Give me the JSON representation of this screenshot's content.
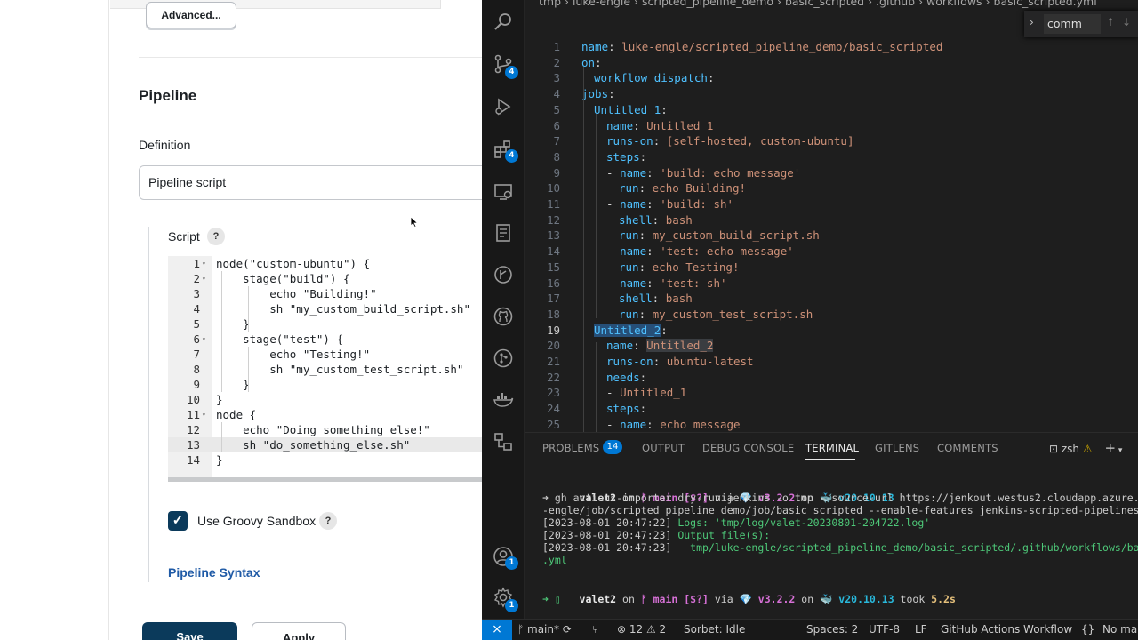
{
  "jenkins": {
    "advanced_button": "Advanced...",
    "section_title": "Pipeline",
    "definition_label": "Definition",
    "definition_value": "Pipeline script",
    "script_label": "Script",
    "help_glyph": "?",
    "script_lines": [
      {
        "n": "1",
        "fold": "▾",
        "code": "node(\"custom-ubuntu\") {"
      },
      {
        "n": "2",
        "fold": "▾",
        "code": "    stage(\"build\") {"
      },
      {
        "n": "3",
        "fold": "",
        "code": "        echo \"Building!\""
      },
      {
        "n": "4",
        "fold": "",
        "code": "        sh \"my_custom_build_script.sh\""
      },
      {
        "n": "5",
        "fold": "",
        "code": "    }"
      },
      {
        "n": "6",
        "fold": "▾",
        "code": "    stage(\"test\") {"
      },
      {
        "n": "7",
        "fold": "",
        "code": "        echo \"Testing!\""
      },
      {
        "n": "8",
        "fold": "",
        "code": "        sh \"my_custom_test_script.sh\""
      },
      {
        "n": "9",
        "fold": "",
        "code": "    }"
      },
      {
        "n": "10",
        "fold": "",
        "code": "}"
      },
      {
        "n": "11",
        "fold": "▾",
        "code": "node {"
      },
      {
        "n": "12",
        "fold": "",
        "code": "    echo \"Doing something else!\""
      },
      {
        "n": "13",
        "fold": "",
        "code": "    sh \"do_something_else.sh\""
      },
      {
        "n": "14",
        "fold": "",
        "code": "}"
      }
    ],
    "active_script_line": "13",
    "sandbox_label": "Use Groovy Sandbox",
    "sandbox_checked": true,
    "pipeline_syntax_link": "Pipeline Syntax",
    "save_button": "Save",
    "apply_button": "Apply"
  },
  "vscode": {
    "breadcrumb": "tmp  ›  luke-engle  ›  scripted_pipeline_demo  ›  basic_scripted  ›  .github  ›  workflows  ›  basic_scripted.yml",
    "find_text": "comm",
    "activity_badges": {
      "source_control": "4",
      "extensions": "4",
      "accounts": "1",
      "settings": "1"
    },
    "yaml_lines": [
      {
        "n": "1",
        "indent": 0,
        "key": "name",
        "val": "luke-engle/scripted_pipeline_demo/basic_scripted"
      },
      {
        "n": "2",
        "indent": 0,
        "key": "on",
        "val": ""
      },
      {
        "n": "3",
        "indent": 1,
        "key": "workflow_dispatch",
        "val": ""
      },
      {
        "n": "4",
        "indent": 0,
        "key": "jobs",
        "val": ""
      },
      {
        "n": "5",
        "indent": 1,
        "key": "Untitled_1",
        "val": ""
      },
      {
        "n": "6",
        "indent": 2,
        "key": "name",
        "val": "Untitled_1"
      },
      {
        "n": "7",
        "indent": 2,
        "key": "runs-on",
        "val": "[self-hosted, custom-ubuntu]"
      },
      {
        "n": "8",
        "indent": 2,
        "key": "steps",
        "val": ""
      },
      {
        "n": "9",
        "indent": 2,
        "dash": true,
        "key": "name",
        "val": "'build: echo message'"
      },
      {
        "n": "10",
        "indent": 3,
        "key": "run",
        "val": "echo Building!"
      },
      {
        "n": "11",
        "indent": 2,
        "dash": true,
        "key": "name",
        "val": "'build: sh'"
      },
      {
        "n": "12",
        "indent": 3,
        "key": "shell",
        "val": "bash"
      },
      {
        "n": "13",
        "indent": 3,
        "key": "run",
        "val": "my_custom_build_script.sh"
      },
      {
        "n": "14",
        "indent": 2,
        "dash": true,
        "key": "name",
        "val": "'test: echo message'"
      },
      {
        "n": "15",
        "indent": 3,
        "key": "run",
        "val": "echo Testing!"
      },
      {
        "n": "16",
        "indent": 2,
        "dash": true,
        "key": "name",
        "val": "'test: sh'"
      },
      {
        "n": "17",
        "indent": 3,
        "key": "shell",
        "val": "bash"
      },
      {
        "n": "18",
        "indent": 3,
        "key": "run",
        "val": "my_custom_test_script.sh"
      },
      {
        "n": "19",
        "indent": 1,
        "key": "Untitled_2",
        "val": "",
        "highlight": true
      },
      {
        "n": "20",
        "indent": 2,
        "key": "name",
        "val": "Untitled_2",
        "valhl": true
      },
      {
        "n": "21",
        "indent": 2,
        "key": "runs-on",
        "val": "ubuntu-latest"
      },
      {
        "n": "22",
        "indent": 2,
        "key": "needs",
        "val": ""
      },
      {
        "n": "23",
        "indent": 2,
        "dash": true,
        "key": "",
        "val": "Untitled_1"
      },
      {
        "n": "24",
        "indent": 2,
        "key": "steps",
        "val": ""
      },
      {
        "n": "25",
        "indent": 2,
        "dash": true,
        "key": "name",
        "val": "echo message"
      }
    ],
    "current_line": "19",
    "panel_tabs": [
      "PROBLEMS",
      "OUTPUT",
      "DEBUG CONSOLE",
      "TERMINAL",
      "GITLENS",
      "COMMENTS"
    ],
    "problems_count": "14",
    "active_tab": "TERMINAL",
    "terminal_shell": "zsh",
    "terminal": {
      "prompt1": {
        "user": "valet2",
        "on1": " on ",
        "branch": "ᚠ main [$?]",
        "via": " via ",
        "ruby": "💎 v3.2.2",
        "on2": " on ",
        "docker": "🐳 v20.10.13",
        "took": ""
      },
      "cmd_line1": "➜ gh actions-importer dry-run jenkins -o tmp --source-url https://jenkout.westus2.cloudapp.azure.co",
      "cmd_line2": "-engle/job/scripted_pipeline_demo/job/basic_scripted --enable-features jenkins-scripted-pipelines",
      "log1_ts": "[2023-08-01 20:47:22]",
      "log1_text": " Logs: 'tmp/log/valet-20230801-204722.log'",
      "log2_ts": "[2023-08-01 20:47:23]",
      "log2_text": " Output file(s):",
      "log3_ts": "[2023-08-01 20:47:23]",
      "log3_text": "   tmp/luke-engle/scripted_pipeline_demo/basic_scripted/.github/workflows/bas",
      "log4_text": ".yml",
      "prompt2": {
        "user": "valet2",
        "on1": " on ",
        "branch": "ᚠ main [$?]",
        "via": " via ",
        "ruby": "💎 v3.2.2",
        "on2": " on ",
        "docker": "🐳 v20.10.13",
        "took_label": " took ",
        "took": "5.2s"
      },
      "prompt_arrow": "➜ ▯"
    },
    "status": {
      "branch": "main*",
      "errors": "12",
      "warnings": "2",
      "sorbet": "Sorbet: Idle",
      "spaces": "Spaces: 2",
      "encoding": "UTF-8",
      "eol": "LF",
      "language": "GitHub Actions Workflow",
      "extra": "No ma"
    },
    "colors": {
      "accent": "#0078d4",
      "key": "#4fc1ff",
      "value": "#ce9178"
    }
  }
}
